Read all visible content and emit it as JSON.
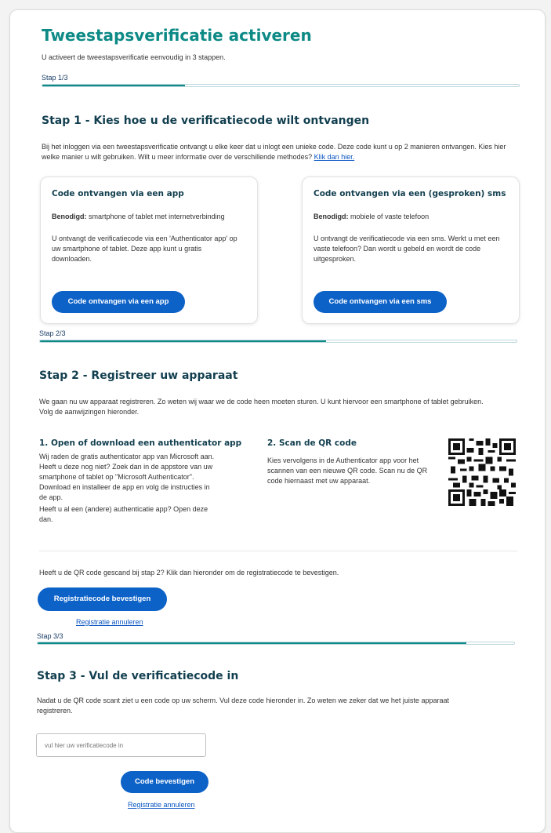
{
  "title": "Tweestapsverificatie activeren",
  "subtitle": "U activeert de tweestapsverificatie eenvoudig in 3 stappen.",
  "progress": [
    {
      "label": "Stap 1/3",
      "fraction": 0.3
    },
    {
      "label": "Stap 2/3",
      "fraction": 0.6
    },
    {
      "label": "Stap 3/3",
      "fraction": 0.9
    }
  ],
  "step1": {
    "heading": "Stap 1 - Kies hoe u de verificatiecode wilt ontvangen",
    "intro": "Bij het inloggen via een tweestapsverificatie ontvangt u elke keer dat u inlogt een unieke code. Deze code kunt u op 2 manieren ontvangen. Kies hier welke manier u wilt gebruiken. Wilt u meer informatie over de verschillende methodes?",
    "intro_link": "Klik dan hier.",
    "app_option": {
      "title": "Code ontvangen via een app",
      "needed_label": "Benodigd:",
      "needed_text": "smartphone of tablet met internetverbinding",
      "description": "U ontvangt de verificatiecode via een 'Authenticator app' op uw smartphone of tablet. Deze app kunt u gratis downloaden.",
      "button": "Code ontvangen via een app"
    },
    "sms_option": {
      "title": "Code ontvangen via een (gesproken) sms",
      "needed_label": "Benodigd:",
      "needed_text": "mobiele of vaste telefoon",
      "description": "U ontvangt de verificatiecode via een sms. Werkt u met een vaste telefoon? Dan wordt u gebeld en wordt de code uitgesproken.",
      "button": "Code ontvangen via een sms"
    }
  },
  "step2": {
    "heading": "Stap 2 - Registreer uw apparaat",
    "intro": "We gaan nu uw apparaat registreren. Zo weten wij waar we de code heen moeten sturen. U kunt hiervoor een smartphone of tablet gebruiken. Volg de aanwijzingen hieronder.",
    "app_heading": "1. Open of download een authenticator app",
    "app_text": "Wij raden de gratis authenticator app van Microsoft aan. Heeft u deze nog niet? Zoek dan in de appstore van uw smartphone of tablet op \"Microsoft Authenticator\". Download en installeer de app en volg de instructies in de app.",
    "app_text2": "Heeft u al een (andere) authenticatie app? Open deze dan.",
    "qr_heading": "2. Scan de QR code",
    "qr_text": "Kies vervolgens in de Authenticator app voor het scannen van een nieuwe QR code. Scan nu de QR code hiernaast met uw apparaat.",
    "confirm_text": "Heeft u de QR code gescand bij stap 2? Klik dan hieronder om de registratiecode te bevestigen.",
    "confirm_button": "Registratiecode bevestigen",
    "cancel_link": "Registratie annuleren"
  },
  "step3": {
    "heading": "Stap 3 - Vul de verificatiecode in",
    "intro": "Nadat u de QR code scant ziet u een code op uw scherm. Vul deze code hieronder in. Zo weten we zeker dat we het juiste apparaat registreren.",
    "input_placeholder": "vul hier uw verificatiecode in",
    "submit_button": "Code bevestigen",
    "cancel_link": "Registratie annuleren"
  },
  "colors": {
    "accent": "#0d8a86",
    "button": "#0d62c8",
    "link": "#0a56c2",
    "heading": "#123f4f"
  }
}
